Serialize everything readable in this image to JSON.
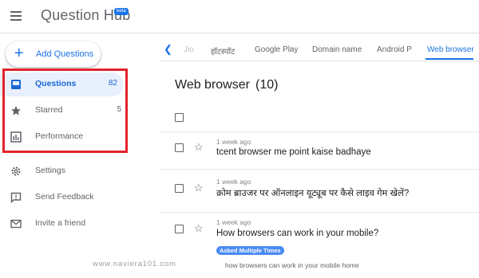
{
  "header": {
    "app_title": "Question Hub",
    "beta_label": "beta"
  },
  "sidebar": {
    "add_button_label": "Add Questions",
    "items": [
      {
        "label": "Questions",
        "count": "82",
        "icon": "inbox-icon",
        "active": true
      },
      {
        "label": "Starred",
        "count": "5",
        "icon": "star-icon",
        "active": false
      },
      {
        "label": "Performance",
        "count": "",
        "icon": "bar-chart-icon",
        "active": false
      },
      {
        "label": "Settings",
        "count": "",
        "icon": "gear-icon",
        "active": false
      },
      {
        "label": "Send Feedback",
        "count": "",
        "icon": "feedback-icon",
        "active": false
      },
      {
        "label": "Invite a friend",
        "count": "",
        "icon": "mail-icon",
        "active": false
      }
    ]
  },
  "tabs": [
    {
      "label": "Jio",
      "state": "faded"
    },
    {
      "label": "हॉटस्पॉट",
      "state": "normal"
    },
    {
      "label": "Google Play",
      "state": "normal"
    },
    {
      "label": "Domain name",
      "state": "normal"
    },
    {
      "label": "Android P",
      "state": "normal"
    },
    {
      "label": "Web browser",
      "state": "active"
    }
  ],
  "main": {
    "title": "Web browser",
    "count": "(10)",
    "questions": [
      {
        "time": "1 week ago",
        "text": "tcent browser me point kaise badhaye"
      },
      {
        "time": "1 week ago",
        "text": "क्रोम ब्राउजर पर ऑनलाइन यूट्यूब पर कैसे लाइव गेम खेलें?"
      },
      {
        "time": "1 week ago",
        "text": "How browsers can work in your mobile?",
        "badge": "Asked Multiple Times",
        "subtext": "how browsers can work in your mobile home"
      }
    ]
  },
  "watermark": "www.naviera101.com",
  "colors": {
    "accent": "#1a73e8",
    "highlight_border": "#e2232a",
    "active_bg": "#e8f0fe"
  }
}
